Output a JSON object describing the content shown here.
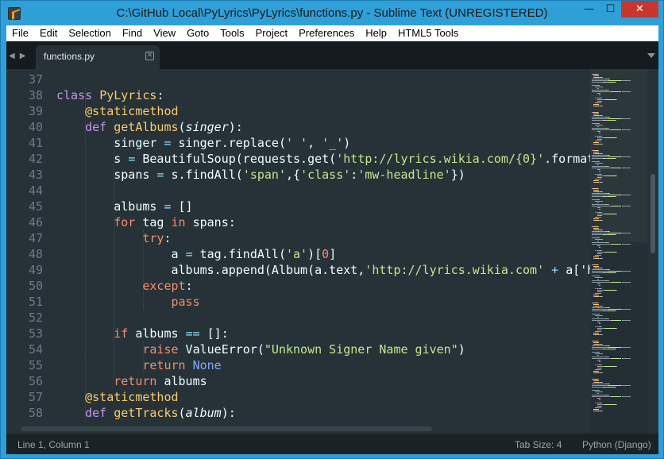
{
  "window": {
    "title": "C:\\GitHub Local\\PyLyrics\\PyLyrics\\functions.py - Sublime Text (UNREGISTERED)",
    "minimize_glyph": "—",
    "maximize_glyph": "☐",
    "close_glyph": "✕"
  },
  "menu": [
    "File",
    "Edit",
    "Selection",
    "Find",
    "View",
    "Goto",
    "Tools",
    "Project",
    "Preferences",
    "Help",
    "HTML5 Tools"
  ],
  "tabs": [
    {
      "label": "functions.py",
      "active": true
    }
  ],
  "editor": {
    "line_numbers": [
      "37",
      "38",
      "39",
      "40",
      "41",
      "42",
      "43",
      "44",
      "45",
      "46",
      "47",
      "48",
      "49",
      "50",
      "51",
      "52",
      "53",
      "54",
      "55",
      "56",
      "57",
      "58"
    ],
    "lines": [
      [],
      [
        [
          "def",
          "class "
        ],
        [
          "cls",
          "PyLyrics"
        ],
        [
          "plain",
          ":"
        ]
      ],
      [
        [
          "plain",
          "    "
        ],
        [
          "dec",
          "@staticmethod"
        ]
      ],
      [
        [
          "plain",
          "    "
        ],
        [
          "def",
          "def "
        ],
        [
          "fn",
          "getAlbums"
        ],
        [
          "plain",
          "("
        ],
        [
          "arg",
          "singer"
        ],
        [
          "plain",
          "):"
        ]
      ],
      [
        [
          "plain",
          "        singer "
        ],
        [
          "op",
          "="
        ],
        [
          "plain",
          " singer.replace("
        ],
        [
          "str",
          "' '"
        ],
        [
          "plain",
          ", "
        ],
        [
          "str",
          "'_'"
        ],
        [
          "plain",
          ")"
        ]
      ],
      [
        [
          "plain",
          "        s "
        ],
        [
          "op",
          "="
        ],
        [
          "plain",
          " BeautifulSoup(requests.get("
        ],
        [
          "str",
          "'http://lyrics.wikia.com/{0}'"
        ],
        [
          "plain",
          ".format(singer)).text)"
        ]
      ],
      [
        [
          "plain",
          "        spans "
        ],
        [
          "op",
          "="
        ],
        [
          "plain",
          " s.findAll("
        ],
        [
          "str",
          "'span'"
        ],
        [
          "plain",
          ",{"
        ],
        [
          "str",
          "'class'"
        ],
        [
          "plain",
          ":"
        ],
        [
          "str",
          "'mw-headline'"
        ],
        [
          "plain",
          "})"
        ]
      ],
      [],
      [
        [
          "plain",
          "        albums "
        ],
        [
          "op",
          "="
        ],
        [
          "plain",
          " []"
        ]
      ],
      [
        [
          "plain",
          "        "
        ],
        [
          "ctl",
          "for"
        ],
        [
          "plain",
          " tag "
        ],
        [
          "ctl",
          "in"
        ],
        [
          "plain",
          " spans:"
        ]
      ],
      [
        [
          "plain",
          "            "
        ],
        [
          "ctl",
          "try"
        ],
        [
          "plain",
          ":"
        ]
      ],
      [
        [
          "plain",
          "                a "
        ],
        [
          "op",
          "="
        ],
        [
          "plain",
          " tag.findAll("
        ],
        [
          "str",
          "'a'"
        ],
        [
          "plain",
          ")["
        ],
        [
          "num",
          "0"
        ],
        [
          "plain",
          "]"
        ]
      ],
      [
        [
          "plain",
          "                albums.append(Album(a.text,"
        ],
        [
          "str",
          "'http://lyrics.wikia.com'"
        ],
        [
          "plain",
          " "
        ],
        [
          "op",
          "+"
        ],
        [
          "plain",
          " a['href'],singer))"
        ]
      ],
      [
        [
          "plain",
          "            "
        ],
        [
          "ctl",
          "except"
        ],
        [
          "plain",
          ":"
        ]
      ],
      [
        [
          "plain",
          "                "
        ],
        [
          "ctl",
          "pass"
        ]
      ],
      [],
      [
        [
          "plain",
          "        "
        ],
        [
          "ctl",
          "if"
        ],
        [
          "plain",
          " albums "
        ],
        [
          "op",
          "=="
        ],
        [
          "plain",
          " []:"
        ]
      ],
      [
        [
          "plain",
          "            "
        ],
        [
          "ctl",
          "raise"
        ],
        [
          "plain",
          " ValueError("
        ],
        [
          "str",
          "\"Unknown Signer Name given\""
        ],
        [
          "plain",
          ")"
        ]
      ],
      [
        [
          "plain",
          "            "
        ],
        [
          "ctl",
          "return"
        ],
        [
          "plain",
          " "
        ],
        [
          "const",
          "None"
        ]
      ],
      [
        [
          "plain",
          "        "
        ],
        [
          "ctl",
          "return"
        ],
        [
          "plain",
          " albums"
        ]
      ],
      [
        [
          "plain",
          "    "
        ],
        [
          "dec",
          "@staticmethod"
        ]
      ],
      [
        [
          "plain",
          "    "
        ],
        [
          "def",
          "def "
        ],
        [
          "fn",
          "getTracks"
        ],
        [
          "plain",
          "("
        ],
        [
          "arg",
          "album"
        ],
        [
          "plain",
          "):"
        ]
      ]
    ]
  },
  "status": {
    "position": "Line 1, Column 1",
    "tab_size": "Tab Size: 4",
    "syntax": "Python (Django)"
  },
  "colors": {
    "title_bar": "#2f9fd8",
    "editor_bg": "#263238",
    "keyword": "#c792ea",
    "control": "#f78c6c",
    "function": "#ffcb6b",
    "string": "#c3e88d",
    "constant": "#82aaff"
  }
}
